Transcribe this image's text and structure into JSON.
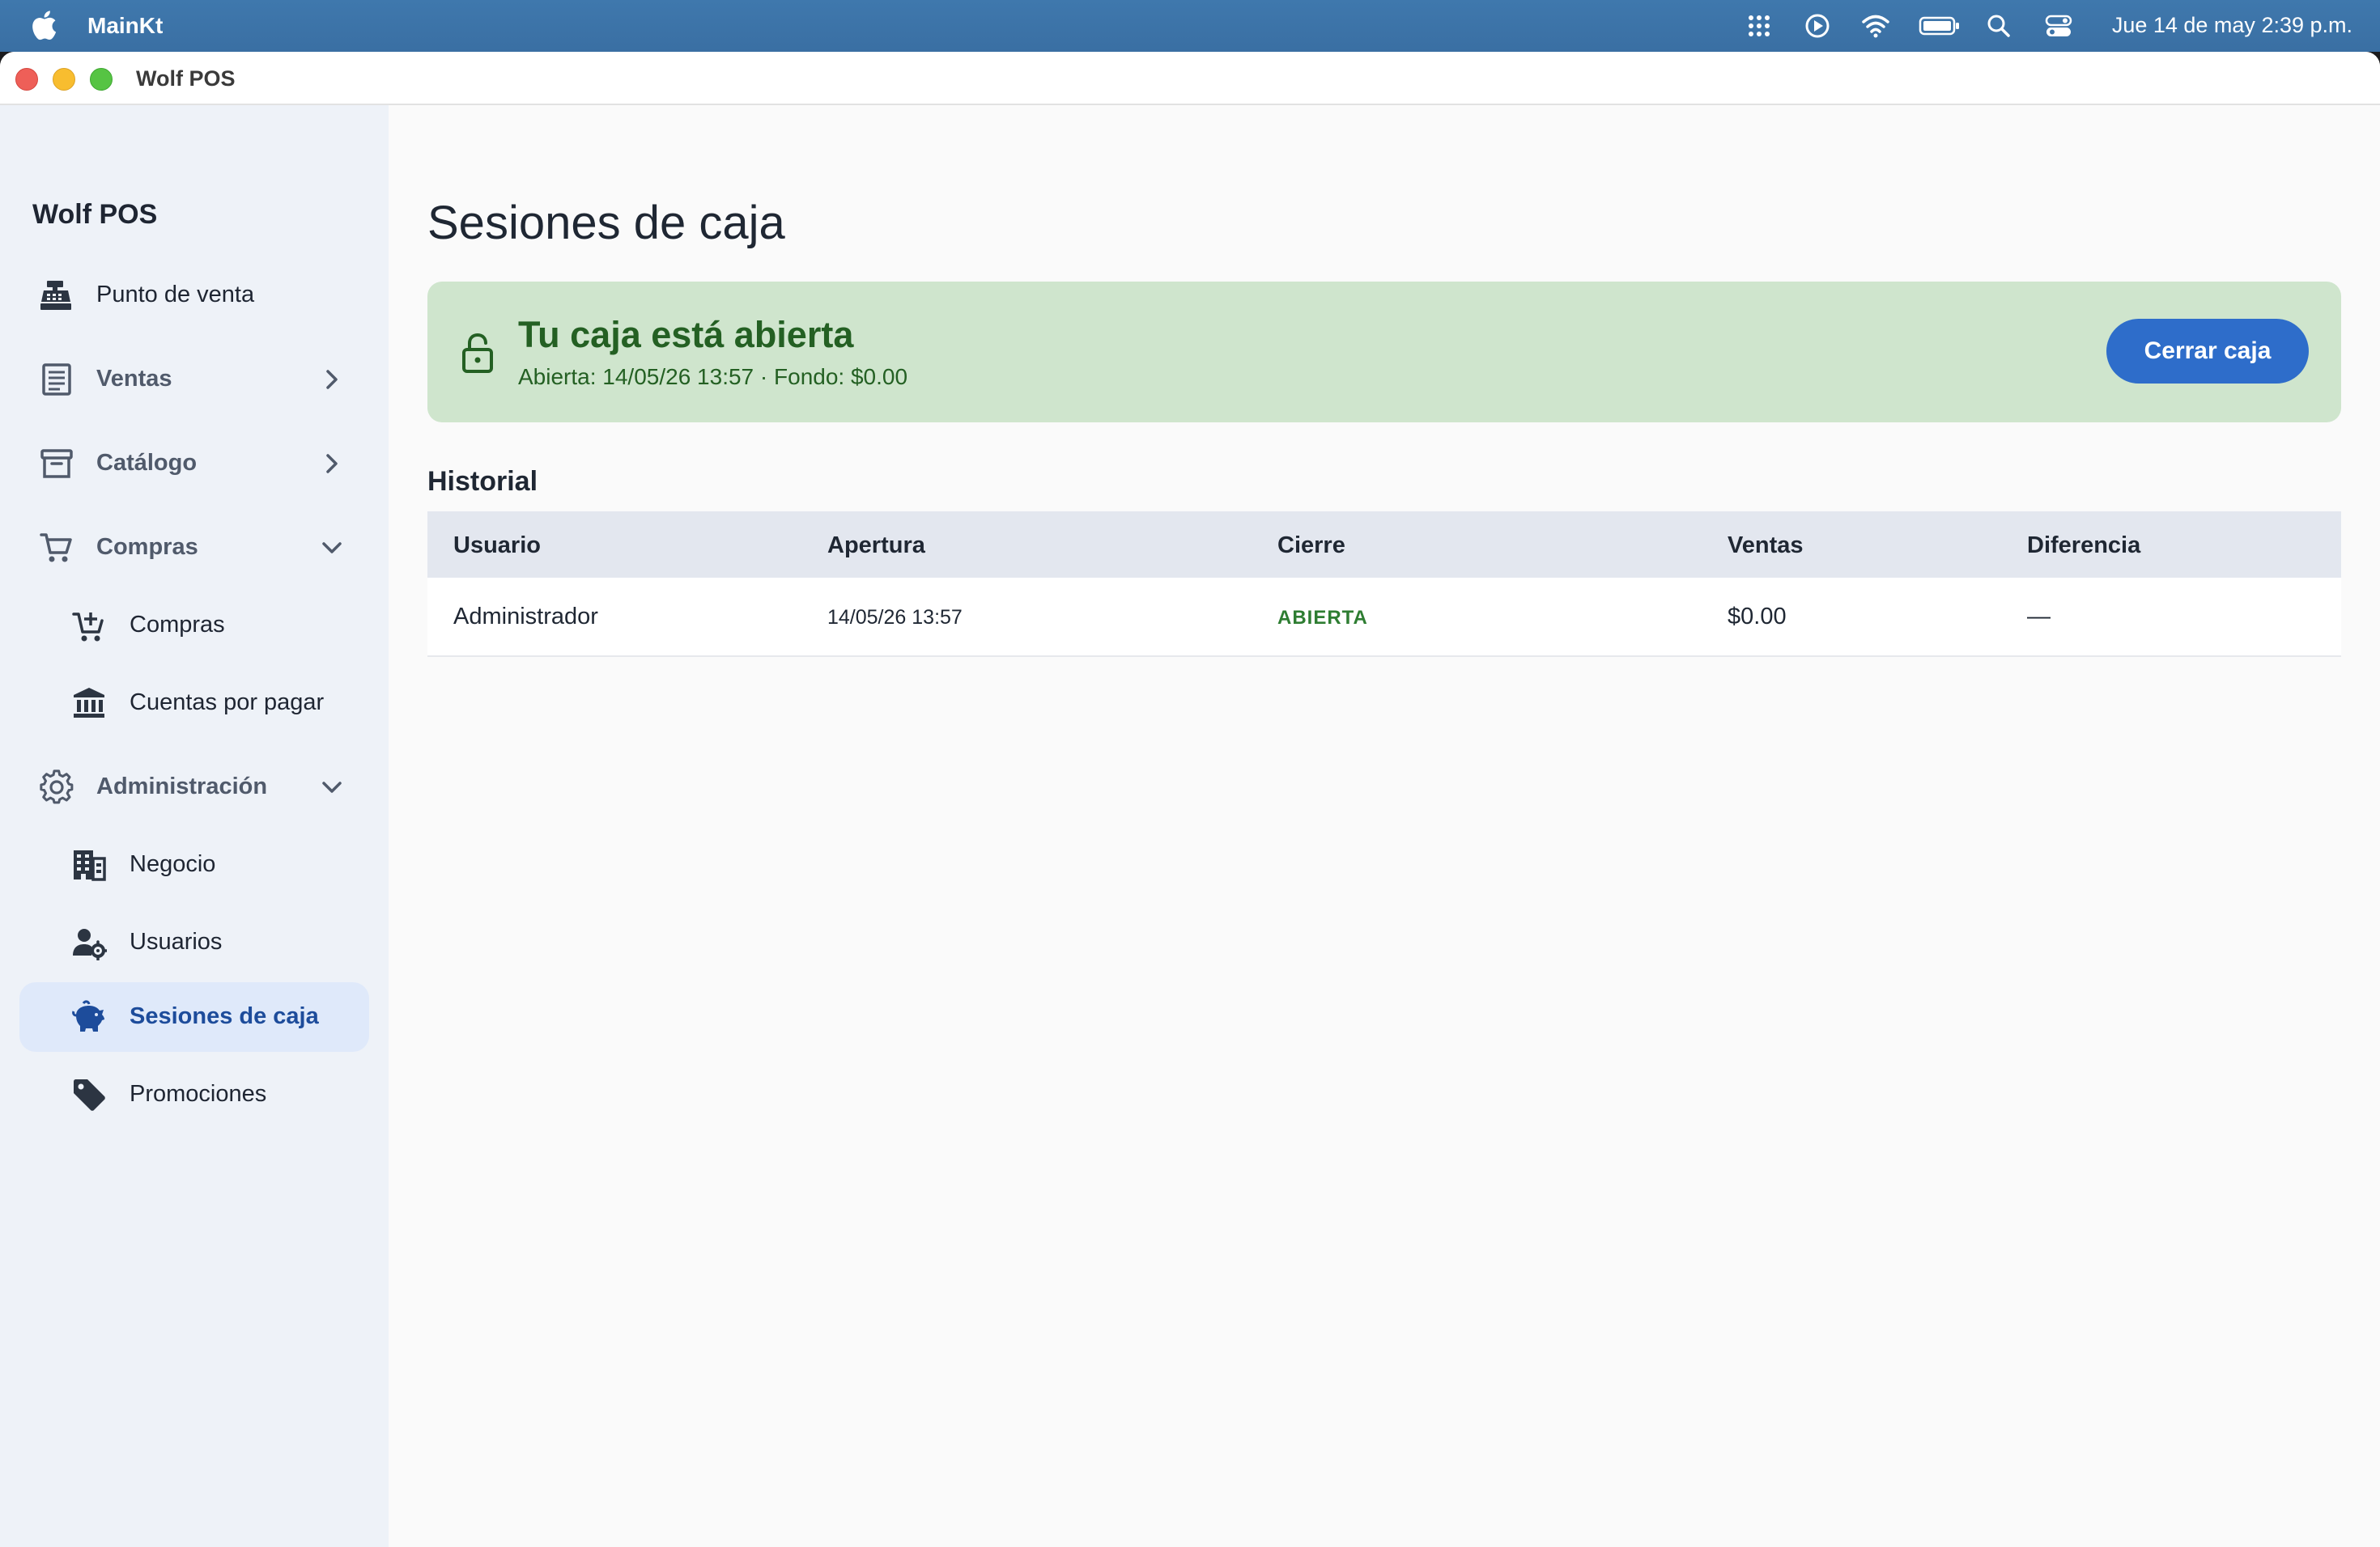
{
  "menubar": {
    "app_name": "MainKt",
    "clock": "Jue 14 de may  2:39 p.m.",
    "icons": [
      "apple-icon",
      "grid-dots-icon",
      "play-circle-icon",
      "wifi-icon",
      "battery-icon",
      "search-icon",
      "control-center-icon"
    ]
  },
  "window": {
    "title": "Wolf POS"
  },
  "sidebar": {
    "brand": "Wolf POS",
    "items": [
      {
        "label": "Punto de venta",
        "icon": "cash-register-icon"
      },
      {
        "label": "Ventas",
        "icon": "receipt-list-icon"
      },
      {
        "label": "Catálogo",
        "icon": "archive-box-icon"
      },
      {
        "label": "Compras",
        "icon": "cart-icon"
      },
      {
        "label": "Compras",
        "icon": "cart-add-icon"
      },
      {
        "label": "Cuentas por pagar",
        "icon": "bank-icon"
      },
      {
        "label": "Administración",
        "icon": "gear-icon"
      },
      {
        "label": "Negocio",
        "icon": "building-icon"
      },
      {
        "label": "Usuarios",
        "icon": "user-gear-icon"
      },
      {
        "label": "Sesiones de caja",
        "icon": "piggy-bank-icon",
        "active": true
      },
      {
        "label": "Promociones",
        "icon": "tag-icon"
      }
    ]
  },
  "main": {
    "title": "Sesiones de caja",
    "banner": {
      "title": "Tu caja está abierta",
      "opened_label": "Abierta: 14/05/26 13:57",
      "separator": " · ",
      "fund_label": "Fondo: $0.00",
      "close_button": "Cerrar caja",
      "color": "#cfe5cd"
    },
    "history_title": "Historial",
    "table": {
      "headers": [
        "Usuario",
        "Apertura",
        "Cierre",
        "Ventas",
        "Diferencia"
      ],
      "rows": [
        {
          "usuario": "Administrador",
          "apertura": "14/05/26 13:57",
          "cierre": "ABIERTA",
          "ventas": "$0.00",
          "diferencia": "—"
        }
      ]
    }
  },
  "colors": {
    "accent": "#2e6dca",
    "success": "#2e7d32",
    "active_nav_bg": "#dfe9fa"
  }
}
